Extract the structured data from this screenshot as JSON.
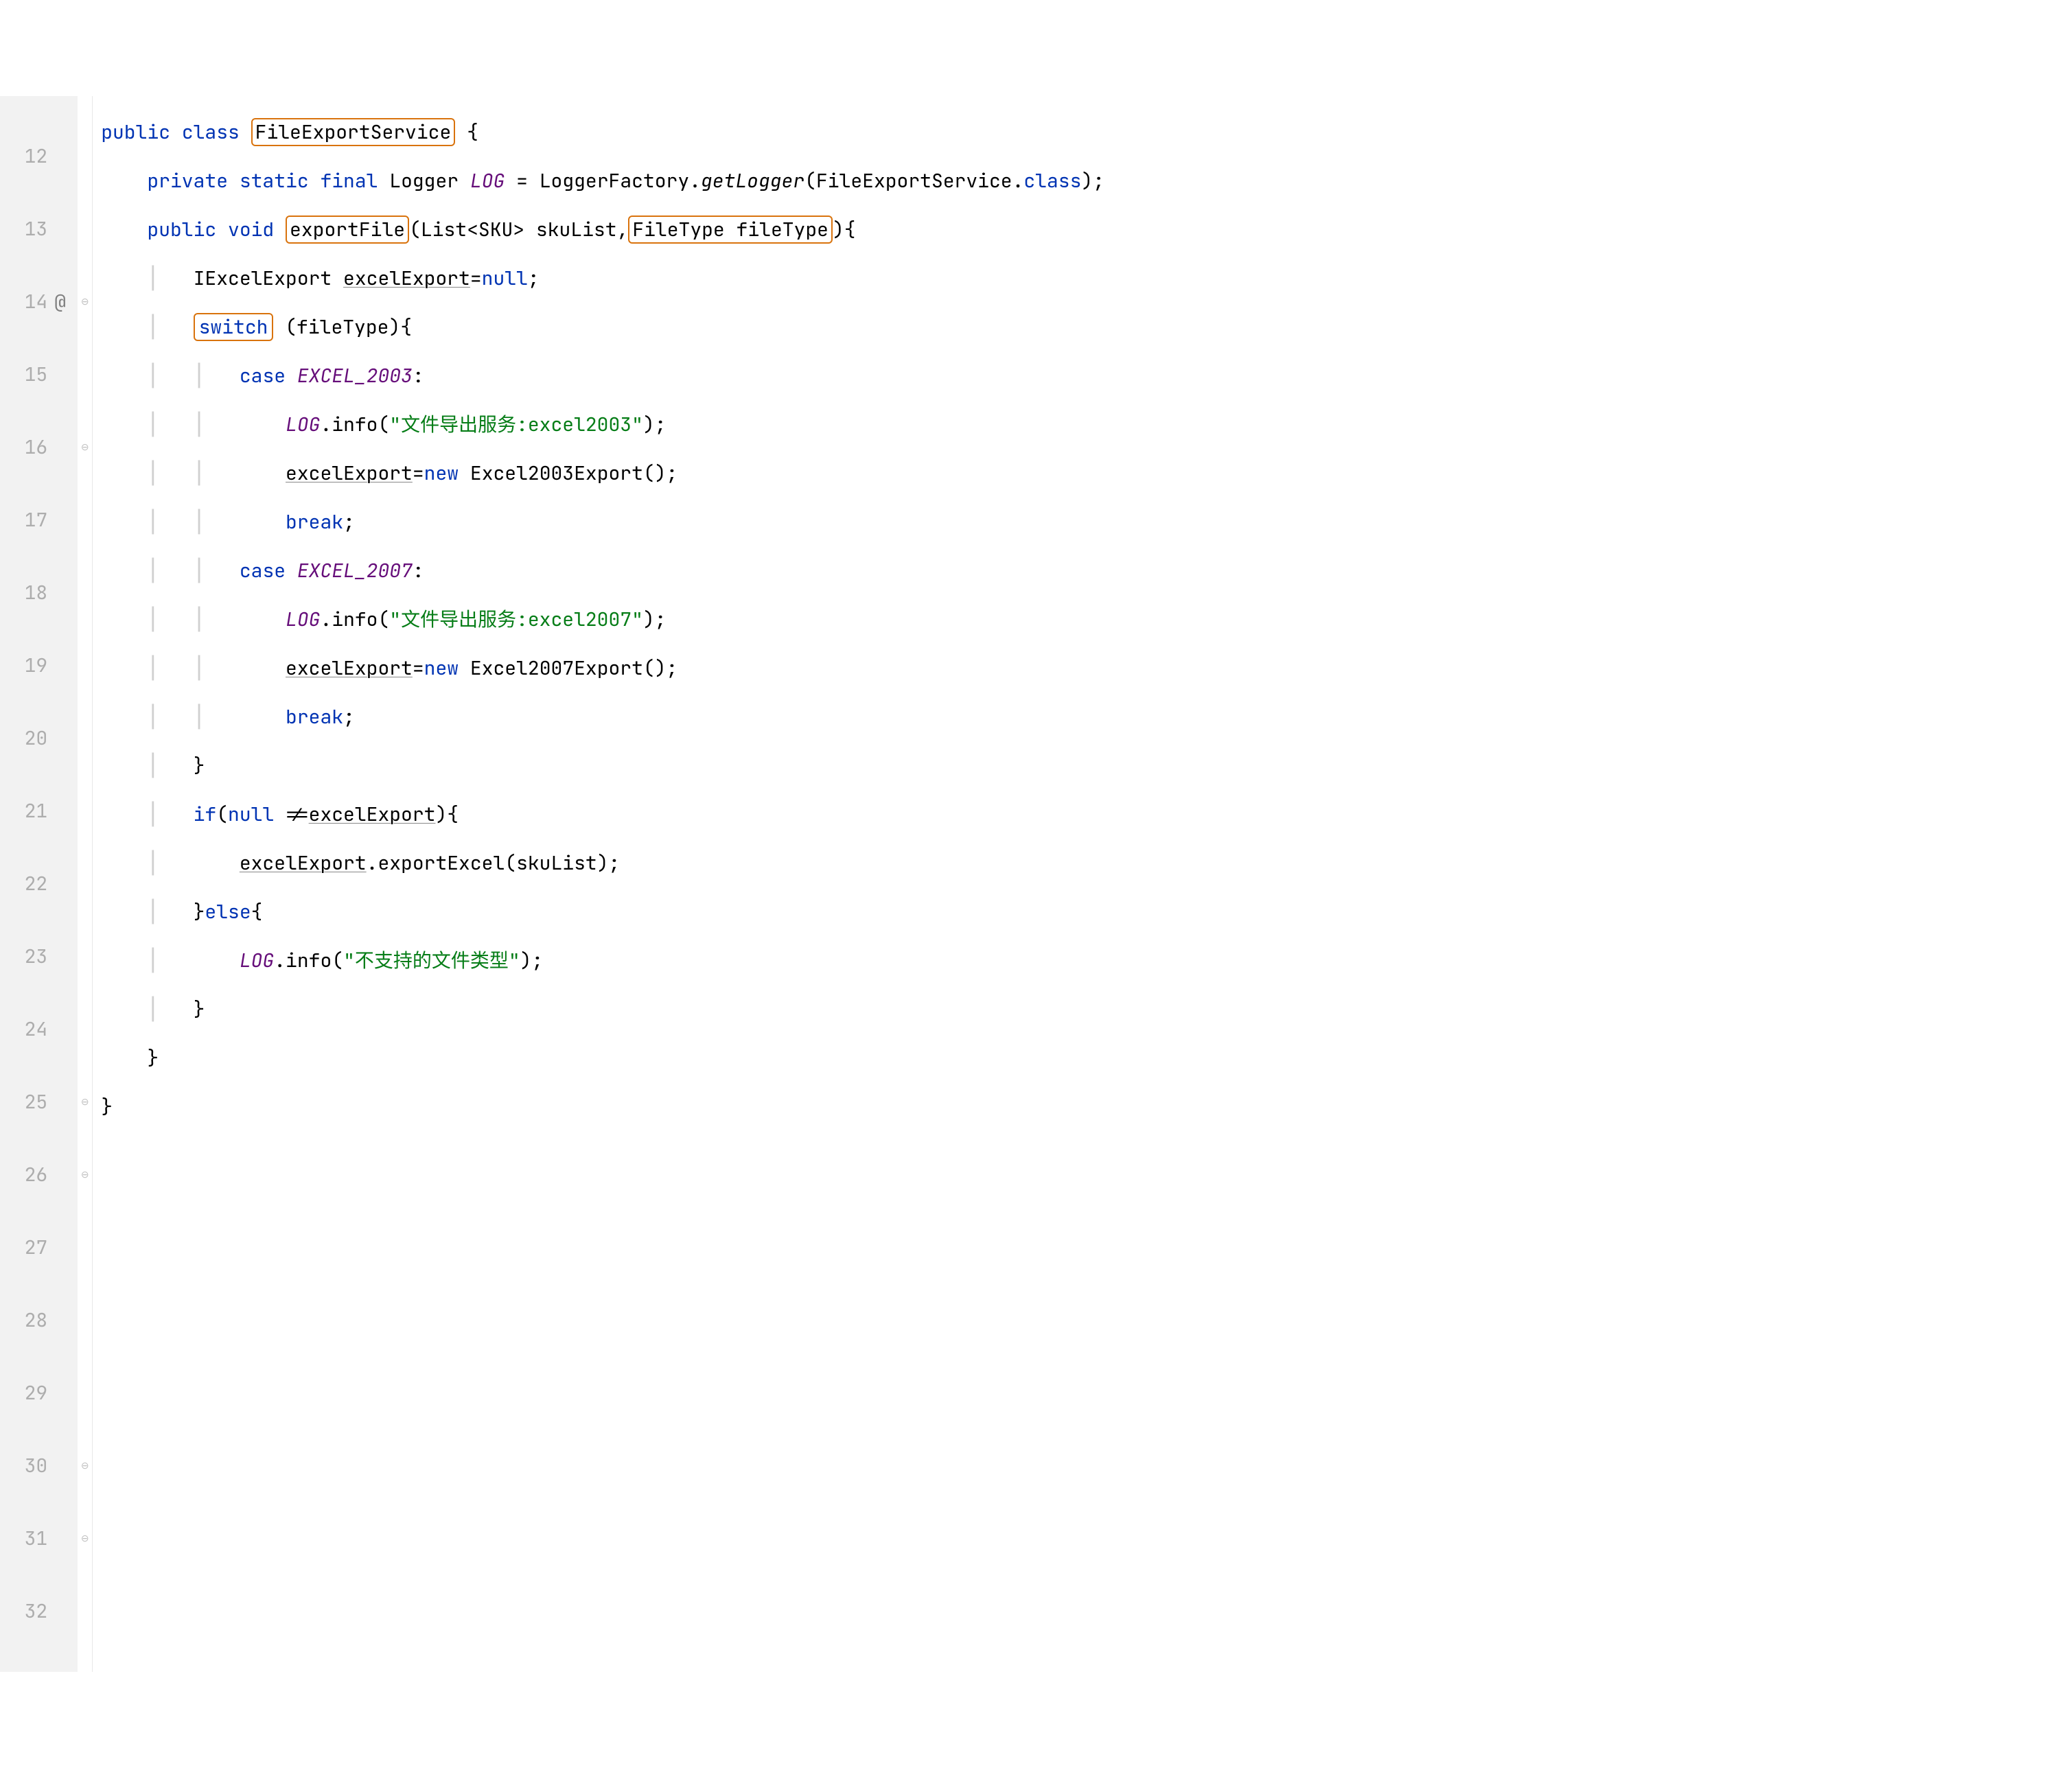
{
  "gutter": {
    "start": 12,
    "end": 32
  },
  "marker_at_line": 14,
  "marker_symbol": "@",
  "tokens": {
    "kw_public": "public",
    "kw_class": "class",
    "kw_private": "private",
    "kw_static": "static",
    "kw_final": "final",
    "kw_void": "void",
    "kw_new": "new",
    "kw_null": "null",
    "kw_switch": "switch",
    "kw_case": "case",
    "kw_break": "break",
    "kw_if": "if",
    "kw_else": "else",
    "kw_class_ref": "class"
  },
  "identifiers": {
    "class_name": "FileExportService",
    "logger_type": "Logger",
    "logger_field": "LOG",
    "logger_factory": "LoggerFactory",
    "get_logger": "getLogger",
    "method_name": "exportFile",
    "list_type": "List",
    "sku_type": "SKU",
    "sku_list": "skuList",
    "file_type_type": "FileType",
    "file_type_var": "fileType",
    "iexcel": "IExcelExport",
    "excel_export": "excelExport",
    "excel2003_const": "EXCEL_2003",
    "excel2007_const": "EXCEL_2007",
    "excel2003_export": "Excel2003Export",
    "excel2007_export": "Excel2007Export",
    "info_method": "info",
    "export_excel_method": "exportExcel"
  },
  "strings": {
    "s1": "\"文件导出服务:excel2003\"",
    "s2": "\"文件导出服务:excel2007\"",
    "s3": "\"不支持的文件类型\""
  }
}
